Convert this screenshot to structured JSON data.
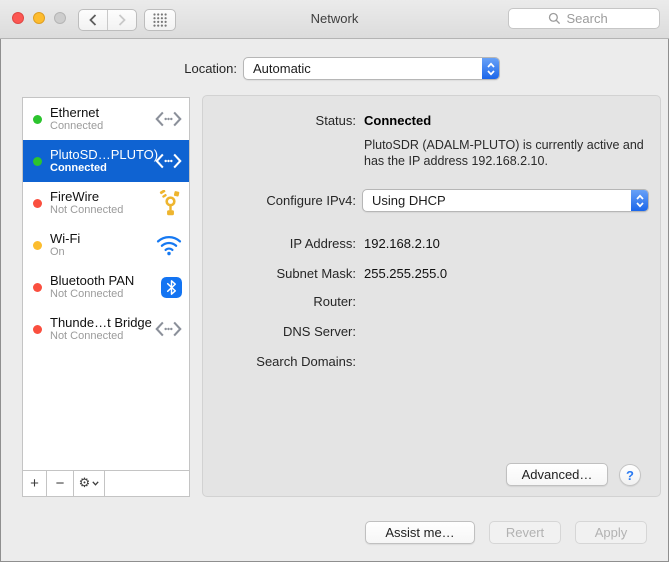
{
  "window": {
    "title": "Network"
  },
  "toolbar": {
    "search_placeholder": "Search"
  },
  "location": {
    "label": "Location:",
    "value": "Automatic"
  },
  "sidebar": {
    "items": [
      {
        "name": "Ethernet",
        "status": "Connected",
        "dot": "green",
        "icon": "ethernet-icon",
        "selected": false
      },
      {
        "name": "PlutoSD…PLUTO)",
        "status": "Connected",
        "dot": "green",
        "icon": "ethernet-icon",
        "selected": true
      },
      {
        "name": "FireWire",
        "status": "Not Connected",
        "dot": "red",
        "icon": "firewire-icon",
        "selected": false
      },
      {
        "name": "Wi-Fi",
        "status": "On",
        "dot": "yellow",
        "icon": "wifi-icon",
        "selected": false
      },
      {
        "name": "Bluetooth PAN",
        "status": "Not Connected",
        "dot": "red",
        "icon": "bluetooth-icon",
        "selected": false
      },
      {
        "name": "Thunde…t Bridge",
        "status": "Not Connected",
        "dot": "red",
        "icon": "ethernet-icon",
        "selected": false
      }
    ],
    "add_label": "+",
    "remove_label": "−"
  },
  "detail": {
    "status_label": "Status:",
    "status_value": "Connected",
    "status_description": "PlutoSDR (ADALM-PLUTO) is currently active and has the IP address 192.168.2.10.",
    "rows": [
      {
        "label": "Configure IPv4:",
        "value": "Using DHCP"
      },
      {
        "label": "IP Address:",
        "value": "192.168.2.10"
      },
      {
        "label": "Subnet Mask:",
        "value": "255.255.255.0"
      },
      {
        "label": "Router:",
        "value": ""
      },
      {
        "label": "DNS Server:",
        "value": ""
      },
      {
        "label": "Search Domains:",
        "value": ""
      }
    ],
    "advanced_label": "Advanced…",
    "help_label": "?"
  },
  "footer": {
    "assist_label": "Assist me…",
    "revert_label": "Revert",
    "apply_label": "Apply"
  },
  "icons": {
    "gear_glyph": "⚙"
  },
  "colors": {
    "selection_blue": "#0f63d2",
    "status_green": "#2cc42e",
    "status_red": "#fa4f3f",
    "status_yellow": "#fcbd2f",
    "icon_blue": "#1374f2",
    "icon_yellow": "#eeb52f",
    "popup_stepper_blue": "#1b66ea"
  }
}
